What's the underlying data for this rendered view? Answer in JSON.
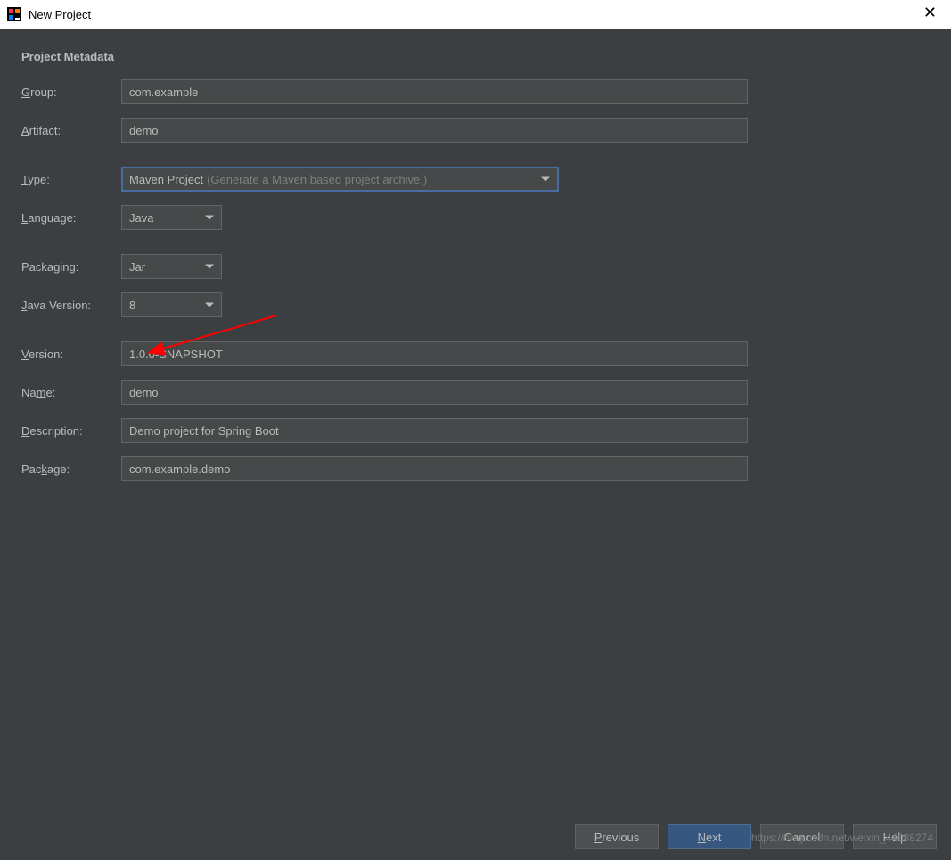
{
  "window": {
    "title": "New Project"
  },
  "section": {
    "title": "Project Metadata"
  },
  "labels": {
    "group_pre": "",
    "group_u": "G",
    "group_post": "roup:",
    "artifact_pre": "",
    "artifact_u": "A",
    "artifact_post": "rtifact:",
    "type_pre": "",
    "type_u": "T",
    "type_post": "ype:",
    "language_pre": "",
    "language_u": "L",
    "language_post": "anguage:",
    "packaging": "Packaging:",
    "javaversion_pre": "",
    "javaversion_u": "J",
    "javaversion_post": "ava Version:",
    "version_pre": "",
    "version_u": "V",
    "version_post": "ersion:",
    "name_pre": "Na",
    "name_u": "m",
    "name_post": "e:",
    "description_pre": "",
    "description_u": "D",
    "description_post": "escription:",
    "package_pre": "Pac",
    "package_u": "k",
    "package_post": "age:"
  },
  "fields": {
    "group": "com.example",
    "artifact": "demo",
    "type_value": "Maven Project",
    "type_hint": "(Generate a Maven based project archive.)",
    "language": "Java",
    "packaging": "Jar",
    "javaVersion": "8",
    "version": "1.0.0-SNAPSHOT",
    "name": "demo",
    "description": "Demo project for Spring Boot",
    "packageName": "com.example.demo"
  },
  "buttons": {
    "previous_pre": "",
    "previous_u": "P",
    "previous_post": "revious",
    "next_pre": "",
    "next_u": "N",
    "next_post": "ext",
    "cancel": "Cancel",
    "help": "Help"
  },
  "watermark": "https://blog.csdn.net/weixin_44088274"
}
